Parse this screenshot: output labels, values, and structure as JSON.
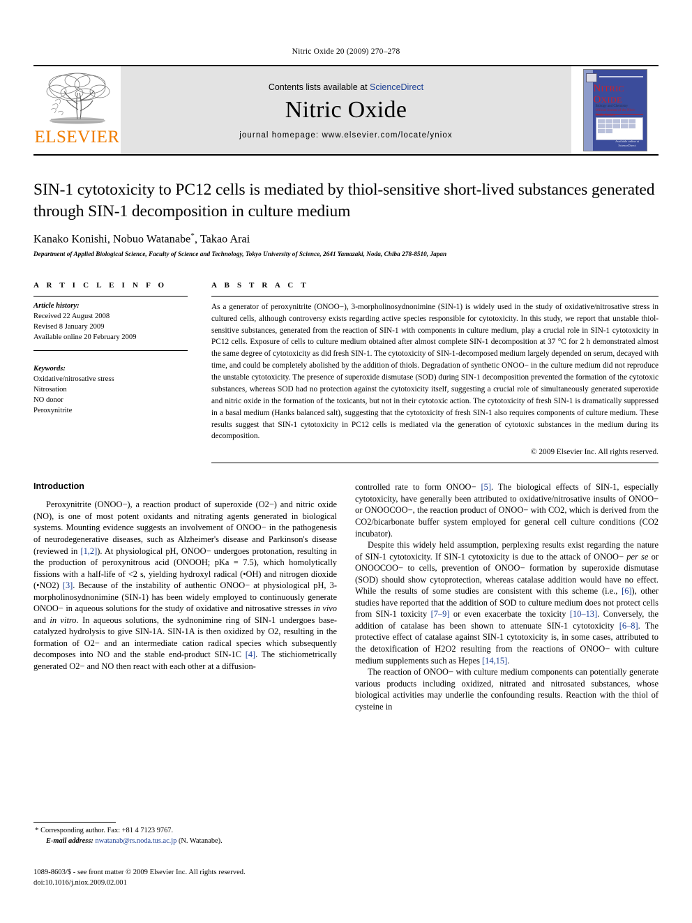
{
  "running_head": "Nitric Oxide 20 (2009) 270–278",
  "masthead": {
    "publisher_logo_word": "ELSEVIER",
    "contents_prefix": "Contents lists available at ",
    "contents_link": "ScienceDirect",
    "journal_name": "Nitric Oxide",
    "homepage": "journal homepage: www.elsevier.com/locate/yniox",
    "cover": {
      "title_line1_initial": "N",
      "title_line1_rest": "ITRIC",
      "title_line2_initial": "O",
      "title_line2_rest": "XIDE",
      "subtitle": "Biology and Chemistry",
      "society_line": "Official Journal of the Nitric Oxide Society",
      "footer": "Available online at\nScienceDirect"
    }
  },
  "article": {
    "title": "SIN-1 cytotoxicity to PC12 cells is mediated by thiol-sensitive short-lived substances generated through SIN-1 decomposition in culture medium",
    "authors_part1": "Kanako Konishi, Nobuo Watanabe",
    "authors_star": "*",
    "authors_part2": ", Takao Arai",
    "affiliation": "Department of Applied Biological Science, Faculty of Science and Technology, Tokyo University of Science, 2641 Yamazaki, Noda, Chiba 278-8510, Japan"
  },
  "info": {
    "heading": "A R T I C L E   I N F O",
    "history_label": "Article history:",
    "history": [
      "Received 22 August 2008",
      "Revised 8 January 2009",
      "Available online 20 February 2009"
    ],
    "keywords_label": "Keywords:",
    "keywords": [
      "Oxidative/nitrosative stress",
      "Nitrosation",
      "NO donor",
      "Peroxynitrite"
    ]
  },
  "abstract": {
    "heading": "A B S T R A C T",
    "text": "As a generator of peroxynitrite (ONOO−), 3-morpholinosydnonimine (SIN-1) is widely used in the study of oxidative/nitrosative stress in cultured cells, although controversy exists regarding active species responsible for cytotoxicity. In this study, we report that unstable thiol-sensitive substances, generated from the reaction of SIN-1 with components in culture medium, play a crucial role in SIN-1 cytotoxicity in PC12 cells. Exposure of cells to culture medium obtained after almost complete SIN-1 decomposition at 37 °C for 2 h demonstrated almost the same degree of cytotoxicity as did fresh SIN-1. The cytotoxicity of SIN-1-decomposed medium largely depended on serum, decayed with time, and could be completely abolished by the addition of thiols. Degradation of synthetic ONOO− in the culture medium did not reproduce the unstable cytotoxicity. The presence of superoxide dismutase (SOD) during SIN-1 decomposition prevented the formation of the cytotoxic substances, whereas SOD had no protection against the cytotoxicity itself, suggesting a crucial role of simultaneously generated superoxide and nitric oxide in the formation of the toxicants, but not in their cytotoxic action. The cytotoxicity of fresh SIN-1 is dramatically suppressed in a basal medium (Hanks balanced salt), suggesting that the cytotoxicity of fresh SIN-1 also requires components of culture medium. These results suggest that SIN-1 cytotoxicity in PC12 cells is mediated via the generation of cytotoxic substances in the medium during its decomposition.",
    "copyright": "© 2009 Elsevier Inc. All rights reserved."
  },
  "body": {
    "introduction_heading": "Introduction",
    "left_paragraph_1": {
      "seg1": "Peroxynitrite (ONOO−), a reaction product of superoxide (O2−) and nitric oxide (NO), is one of most potent oxidants and nitrating agents generated in biological systems. Mounting evidence suggests an involvement of ONOO− in the pathogenesis of neurodegenerative diseases, such as Alzheimer's disease and Parkinson's disease (reviewed in ",
      "ref1": "[1,2]",
      "seg2": "). At physiological pH, ONOO− undergoes protonation, resulting in the production of peroxynitrous acid (ONOOH; pKa = 7.5), which homolytically fissions with a half-life of <2 s, yielding hydroxyl radical (•OH) and nitrogen dioxide (•NO2) ",
      "ref2": "[3]",
      "seg3": ". Because of the instability of authentic ONOO− at physiological pH, 3-morpholinosydnonimine (SIN-1) has been widely employed to continuously generate ONOO− in aqueous solutions for the study of oxidative and nitrosative stresses ",
      "italic1": "in vivo",
      "seg4": " and ",
      "italic2": "in vitro",
      "seg5": ". In aqueous solutions, the sydnonimine ring of SIN-1 undergoes base-catalyzed hydrolysis to give SIN-1A. SIN-1A is then oxidized by O2, resulting in the formation of O2− and an intermediate cation radical species which subsequently decomposes into NO and the stable end-product SIN-1C ",
      "ref3": "[4]",
      "seg6": ". The stichiometrically generated O2− and NO then react with each other at a diffusion-"
    },
    "right_paragraph_1": {
      "seg1": "controlled rate to form ONOO− ",
      "ref1": "[5]",
      "seg2": ". The biological effects of SIN-1, especially cytotoxicity, have generally been attributed to oxidative/nitrosative insults of ONOO− or ONOOCOO−, the reaction product of ONOO− with CO2, which is derived from the CO2/bicarbonate buffer system employed for general cell culture conditions (CO2 incubator)."
    },
    "right_paragraph_2": {
      "seg1": "Despite this widely held assumption, perplexing results exist regarding the nature of SIN-1 cytotoxicity. If SIN-1 cytotoxicity is due to the attack of ONOO− ",
      "italic1": "per se",
      "seg2": " or ONOOCOO− to cells, prevention of ONOO− formation by superoxide dismutase (SOD) should show cytoprotection, whereas catalase addition would have no effect. While the results of some studies are consistent with this scheme (i.e., ",
      "ref1": "[6]",
      "seg3": "), other studies have reported that the addition of SOD to culture medium does not protect cells from SIN-1 toxicity ",
      "ref2": "[7–9]",
      "seg4": " or even exacerbate the toxicity ",
      "ref3": "[10–13]",
      "seg5": ". Conversely, the addition of catalase has been shown to attenuate SIN-1 cytotoxicity ",
      "ref4": "[6–8]",
      "seg6": ". The protective effect of catalase against SIN-1 cytotoxicity is, in some cases, attributed to the detoxification of H2O2 resulting from the reactions of ONOO− with culture medium supplements such as Hepes ",
      "ref5": "[14,15]",
      "seg7": "."
    },
    "right_paragraph_3": {
      "seg1": "The reaction of ONOO− with culture medium components can potentially generate various products including oxidized, nitrated and nitrosated substances, whose biological activities may underlie the confounding results. Reaction with the thiol of cysteine in"
    }
  },
  "footnote": {
    "star": "*",
    "corresponding": " Corresponding author. Fax: +81 4 7123 9767.",
    "email_label": "E-mail address:",
    "email": "nwatanab@rs.noda.tus.ac.jp",
    "email_suffix": " (N. Watanabe)."
  },
  "footer": {
    "line1": "1089-8603/$ - see front matter © 2009 Elsevier Inc. All rights reserved.",
    "line2": "doi:10.1016/j.niox.2009.02.001"
  },
  "colors": {
    "link_blue": "#1c3f94",
    "elsevier_orange": "#f07d00",
    "cover_blue": "#3b4c9b",
    "cover_red": "#d0202a",
    "masthead_gray": "#e3e3e3"
  }
}
